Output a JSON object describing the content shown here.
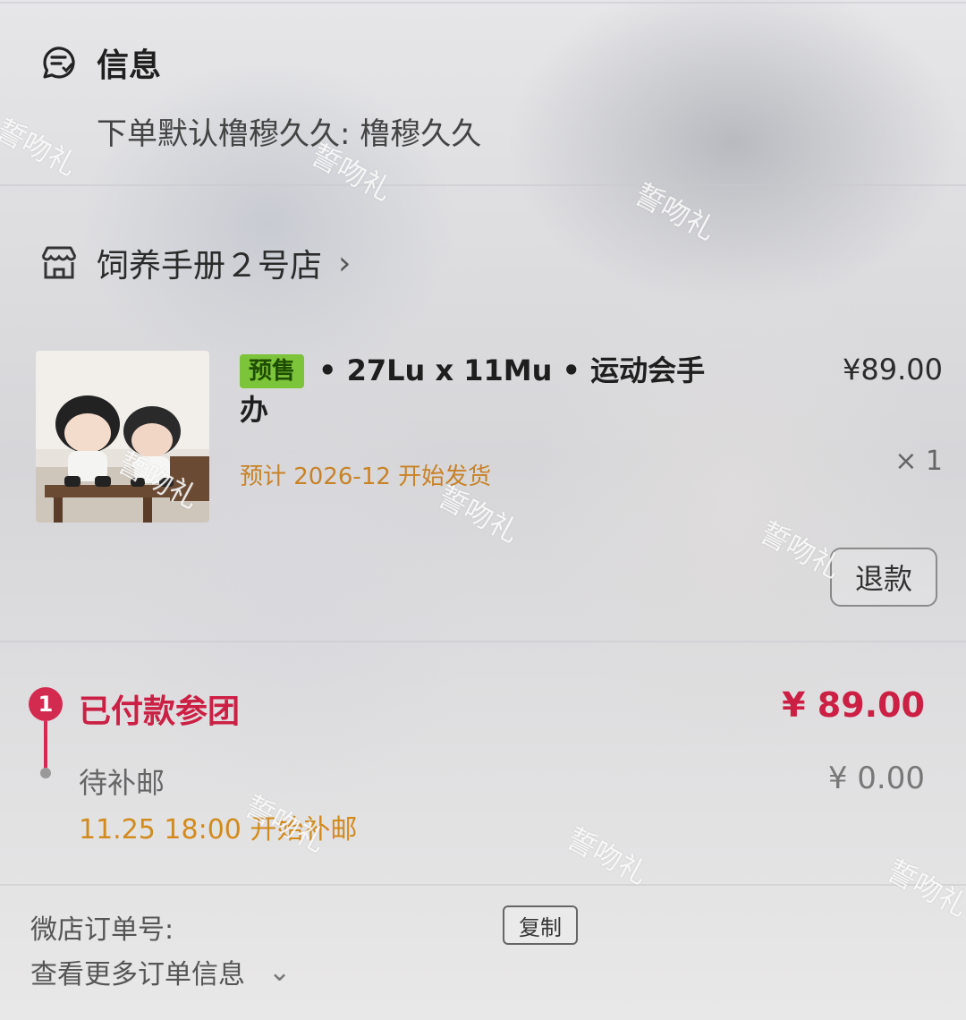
{
  "info": {
    "title": "信息",
    "line": "下单默认橹穆久久: 橹穆久久"
  },
  "shop": {
    "name": "饲养手册２号店"
  },
  "product": {
    "tag": "预售",
    "title": "• 27Lu x 11Mu • 运动会手办",
    "price": "¥89.00",
    "quantity": "× 1",
    "ship_estimate": "预计 2026-12 开始发货",
    "refund_label": "退款"
  },
  "payment": {
    "step_number": "1",
    "paid_label": "已付款参团",
    "paid_amount": "¥ 89.00",
    "pending_label": "待补邮",
    "pending_amount": "¥ 0.00",
    "pending_time": "11.25 18:00 开始补邮"
  },
  "footer": {
    "order_number_label": "微店订单号:",
    "copy_label": "复制",
    "more_label": "查看更多订单信息"
  },
  "watermark": "誓吻礼",
  "colors": {
    "accent_red": "#cc1f44",
    "tag_green": "#7cc43a",
    "orange_text": "#c88227"
  }
}
